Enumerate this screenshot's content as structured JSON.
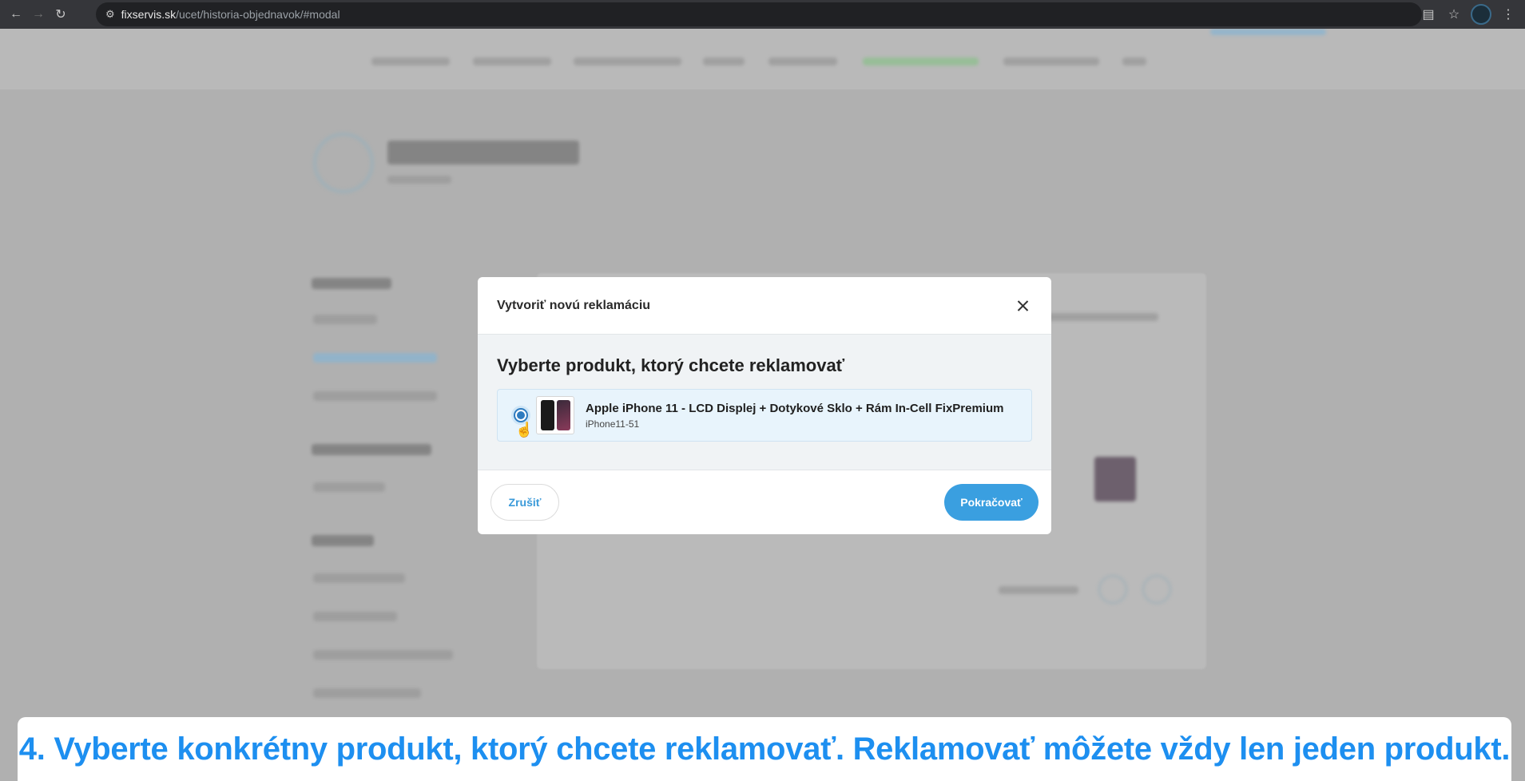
{
  "browser": {
    "url_host": "fixservis.sk",
    "url_path": "/ucet/historia-objednavok/#modal",
    "icons": [
      "back-arrow-icon",
      "forward-arrow-icon",
      "reload-icon",
      "site-settings-icon",
      "card-icon",
      "star-icon",
      "profile-avatar",
      "menu-dots-icon"
    ]
  },
  "modal": {
    "title": "Vytvoriť novú reklamáciu",
    "subtitle": "Vyberte produkt, ktorý chcete reklamovať",
    "product": {
      "name": "Apple iPhone 11 - LCD Displej + Dotykové Sklo + Rám In-Cell FixPremium",
      "code": "iPhone11-51",
      "selected": true
    },
    "cancel_label": "Zrušiť",
    "continue_label": "Pokračovať"
  },
  "caption": {
    "text": "4. Vyberte konkrétny produkt, ktorý chcete reklamovať. Reklamovať môžete vždy len jeden produkt."
  },
  "colors": {
    "accent": "#3a9fe0",
    "caption": "#1d8ff0",
    "overlay": "#b3b3b3"
  }
}
